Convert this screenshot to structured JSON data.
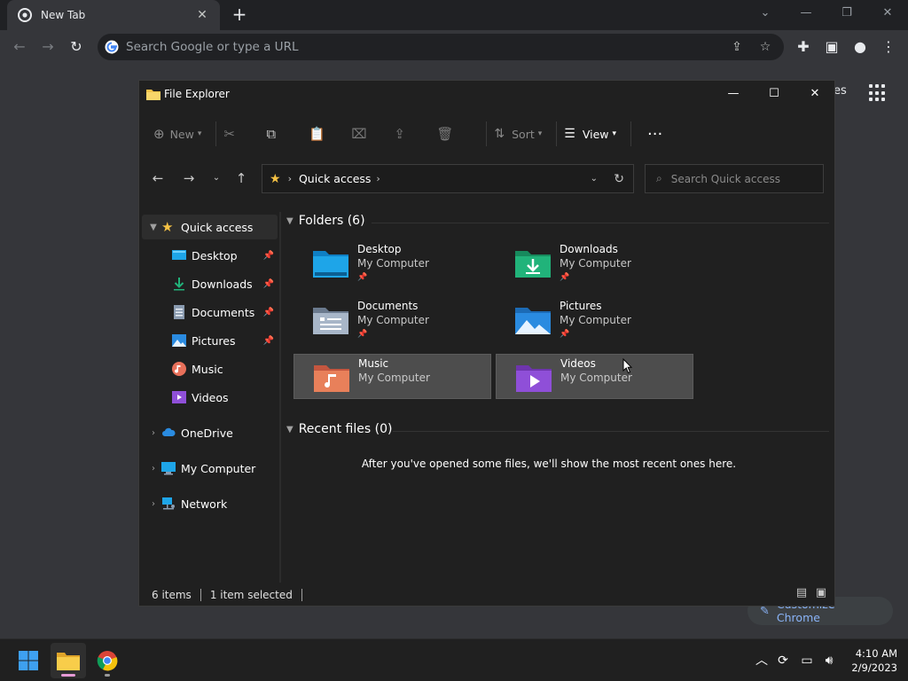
{
  "browser": {
    "tab_title": "New Tab",
    "omnibox_placeholder": "Search Google or type a URL",
    "behind_text": "es",
    "customize_label": "Customize Chrome"
  },
  "explorer": {
    "title": "File Explorer",
    "commands": {
      "new_label": "New",
      "sort_label": "Sort",
      "view_label": "View"
    },
    "address": {
      "location": "Quick access"
    },
    "search_placeholder": "Search Quick access",
    "nav": {
      "quick_access": "Quick access",
      "pinned": [
        {
          "label": "Desktop",
          "icon": "desktop-icon",
          "pinned": true
        },
        {
          "label": "Downloads",
          "icon": "downloads-icon",
          "pinned": true
        },
        {
          "label": "Documents",
          "icon": "documents-icon",
          "pinned": true
        },
        {
          "label": "Pictures",
          "icon": "pictures-icon",
          "pinned": true
        },
        {
          "label": "Music",
          "icon": "music-icon",
          "pinned": false
        },
        {
          "label": "Videos",
          "icon": "videos-icon",
          "pinned": false
        }
      ],
      "onedrive": "OneDrive",
      "my_computer": "My Computer",
      "network": "Network"
    },
    "folders_header": "Folders (6)",
    "folders": [
      {
        "name": "Desktop",
        "location": "My Computer",
        "pinned": true,
        "selected": false,
        "color": "#1ea5e8"
      },
      {
        "name": "Downloads",
        "location": "My Computer",
        "pinned": true,
        "selected": false,
        "color": "#21b37a"
      },
      {
        "name": "Documents",
        "location": "My Computer",
        "pinned": true,
        "selected": false,
        "color": "#8a9bb0"
      },
      {
        "name": "Pictures",
        "location": "My Computer",
        "pinned": true,
        "selected": false,
        "color": "#2a8be0"
      },
      {
        "name": "Music",
        "location": "My Computer",
        "pinned": false,
        "selected": true,
        "color": "#e8705a"
      },
      {
        "name": "Videos",
        "location": "My Computer",
        "pinned": false,
        "selected": true,
        "color": "#8f4fd8"
      }
    ],
    "recent_header": "Recent files (0)",
    "recent_empty": "After you've opened some files, we'll show the most recent ones here.",
    "status": {
      "items": "6 items",
      "selected": "1 item selected"
    }
  },
  "taskbar": {
    "time": "4:10 AM",
    "date": "2/9/2023"
  },
  "colors": {
    "accent_blue": "#8ab4f8",
    "star_yellow": "#f6c244"
  }
}
